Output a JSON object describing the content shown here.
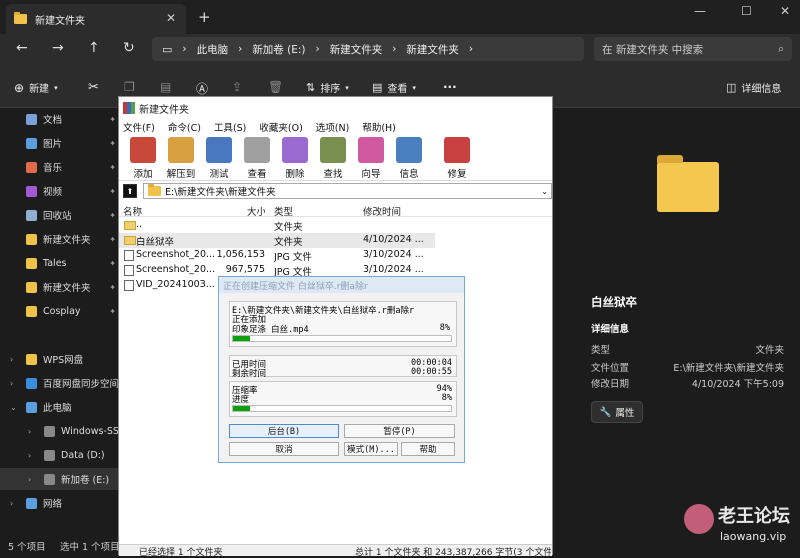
{
  "tab": {
    "title": "新建文件夹"
  },
  "address": {
    "crumbs": [
      "此电脑",
      "新加卷 (E:)",
      "新建文件夹",
      "新建文件夹"
    ],
    "search_placeholder": "在 新建文件夹 中搜索"
  },
  "commands": {
    "new": "新建",
    "sort": "排序",
    "view": "查看",
    "more": "···",
    "details": "详细信息"
  },
  "sidebar": {
    "items": [
      {
        "label": "文档",
        "color": "#7aa0d8"
      },
      {
        "label": "图片",
        "color": "#5a9fe0"
      },
      {
        "label": "音乐",
        "color": "#e06a4a"
      },
      {
        "label": "视频",
        "color": "#a45ad6"
      },
      {
        "label": "回收站",
        "color": "#8fb0d0"
      },
      {
        "label": "新建文件夹",
        "color": "#f0c24a"
      },
      {
        "label": "Tales",
        "color": "#f0c24a"
      },
      {
        "label": "新建文件夹",
        "color": "#f0c24a"
      },
      {
        "label": "Cosplay",
        "color": "#f0c24a"
      }
    ],
    "tree": [
      {
        "label": "WPS网盘",
        "color": "#f0c24a"
      },
      {
        "label": "百度网盘同步空间",
        "color": "#3a8ee0"
      },
      {
        "label": "此电脑",
        "color": "#5a9fe0"
      },
      {
        "label": "Windows-SSD (C",
        "color": "#888888"
      },
      {
        "label": "Data (D:)",
        "color": "#888888"
      },
      {
        "label": "新加卷 (E:)",
        "color": "#888888"
      },
      {
        "label": "网络",
        "color": "#5a9fe0"
      }
    ]
  },
  "details": {
    "name": "白丝狱卒",
    "section": "详细信息",
    "rows": [
      {
        "k": "类型",
        "v": "文件夹"
      },
      {
        "k": "文件位置",
        "v": "E:\\新建文件夹\\新建文件夹"
      },
      {
        "k": "修改日期",
        "v": "4/10/2024 下午5:09"
      }
    ],
    "prop_btn": "属性"
  },
  "status": {
    "left": "5 个项目",
    "sel": "选中 1 个项目"
  },
  "rar": {
    "title": "新建文件夹",
    "menu": [
      "文件(F)",
      "命令(C)",
      "工具(S)",
      "收藏夹(O)",
      "选项(N)",
      "帮助(H)"
    ],
    "tools": [
      {
        "label": "添加",
        "color": "#c8483a"
      },
      {
        "label": "解压到",
        "color": "#d8a040"
      },
      {
        "label": "测试",
        "color": "#4a78c0"
      },
      {
        "label": "查看",
        "color": "#a0a0a0"
      },
      {
        "label": "删除",
        "color": "#9a6ad0"
      },
      {
        "label": "查找",
        "color": "#7a9050"
      },
      {
        "label": "向导",
        "color": "#d05aa0"
      },
      {
        "label": "信息",
        "color": "#4a80c0"
      },
      {
        "label": "修复",
        "color": "#c84040"
      }
    ],
    "path": "E:\\新建文件夹\\新建文件夹",
    "cols": {
      "name": "名称",
      "size": "大小",
      "type": "类型",
      "date": "修改时间"
    },
    "rows": [
      {
        "name": "..",
        "size": "",
        "type": "文件夹",
        "date": ""
      },
      {
        "name": "白丝狱卒",
        "size": "",
        "type": "文件夹",
        "date": "4/10/2024 ..."
      },
      {
        "name": "Screenshot_20...",
        "size": "1,056,153",
        "type": "JPG 文件",
        "date": "3/10/2024 ..."
      },
      {
        "name": "Screenshot_20...",
        "size": "967,575",
        "type": "JPG 文件",
        "date": "3/10/2024 ..."
      },
      {
        "name": "VID_2024100З...",
        "size": "",
        "type": "",
        "date": ""
      }
    ],
    "status_left": "已经选择 1 个文件夹",
    "status_right": "总计 1 个文件夹 和 243,387,266 字节(3 个文件"
  },
  "dialog": {
    "title": "正在创建压缩文件 白丝狱卒.r删a除r",
    "archive": "E:\\新建文件夹\\新建文件夹\\白丝狱卒.r删a除r",
    "action": "正在添加",
    "file": "印象足涤 白丝.mp4",
    "file_pct": "8%",
    "file_progress": 0.08,
    "elapsed_label": "已用时间",
    "elapsed": "00:00:04",
    "remaining_label": "剩余时间",
    "remaining": "00:00:55",
    "ratio_label": "压缩率",
    "ratio": "94%",
    "progress_label": "进度",
    "progress_pct": "8%",
    "total_progress": 0.08,
    "buttons": {
      "background": "后台(B)",
      "pause": "暂停(P)",
      "cancel": "取消",
      "mode": "模式(M)...",
      "help": "帮助"
    }
  },
  "watermark": {
    "text": "老王论坛",
    "url": "laowang.vip"
  }
}
